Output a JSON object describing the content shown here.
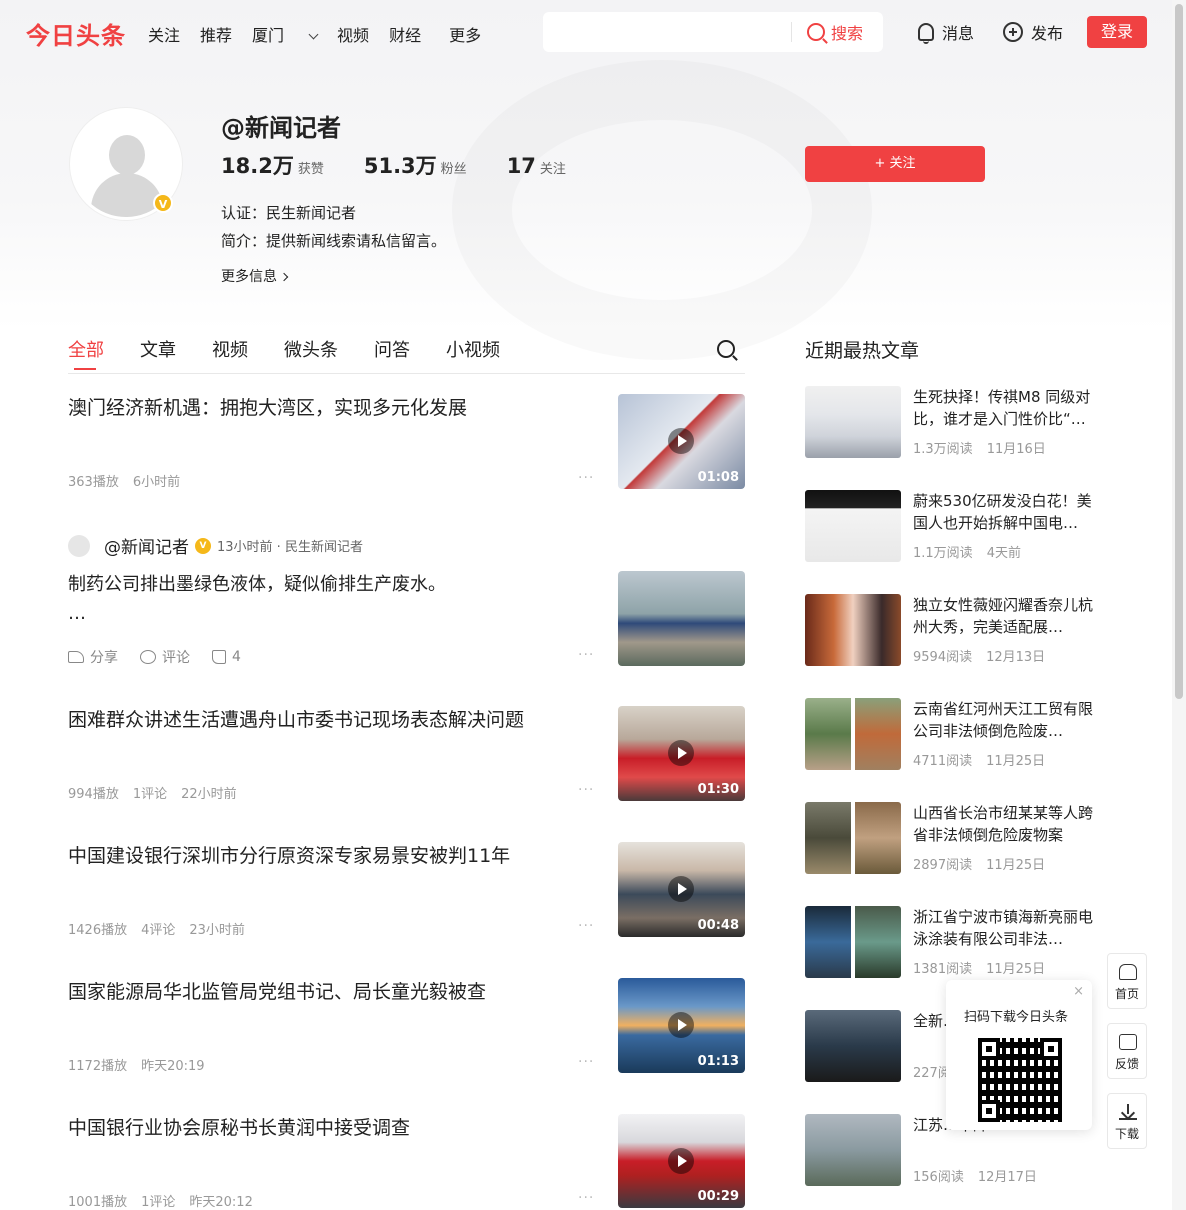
{
  "header": {
    "logo": "今日头条",
    "nav": [
      "关注",
      "推荐",
      "厦门",
      "视频",
      "财经",
      "更多"
    ],
    "search": {
      "placeholder": "",
      "button": "搜索"
    },
    "messages": "消息",
    "publish": "发布",
    "login": "登录"
  },
  "profile": {
    "name": "@新闻记者",
    "verified_badge": "V",
    "stats": [
      {
        "num": "18.2万",
        "unit": "获赞"
      },
      {
        "num": "51.3万",
        "unit": "粉丝"
      },
      {
        "num": "17",
        "unit": "关注"
      }
    ],
    "certification": "认证：民生新闻记者",
    "bio": "简介：提供新闻线索请私信留言。",
    "more_info": "更多信息",
    "follow_button": "+ 关注"
  },
  "tabs": [
    "全部",
    "文章",
    "视频",
    "微头条",
    "问答",
    "小视频"
  ],
  "feed": [
    {
      "title": "澳门经济新机遇：拥抱大湾区，实现多元化发展",
      "meta": [
        "363播放",
        "6小时前"
      ],
      "duration": "01:08"
    },
    {
      "type": "post",
      "author": "@新闻记者",
      "author_badge": "V",
      "time": "13小时前 · 民生新闻记者",
      "text": "制药公司排出墨绿色液体，疑似偷排生产废水。",
      "ellipsis": "…",
      "actions": {
        "share": "分享",
        "comment": "评论",
        "like": "4"
      }
    },
    {
      "title": "困难群众讲述生活遭遇舟山市委书记现场表态解决问题",
      "meta": [
        "994播放",
        "1评论",
        "22小时前"
      ],
      "duration": "01:30"
    },
    {
      "title": "中国建设银行深圳市分行原资深专家易景安被判11年",
      "meta": [
        "1426播放",
        "4评论",
        "23小时前"
      ],
      "duration": "00:48"
    },
    {
      "title": "国家能源局华北监管局党组书记、局长童光毅被查",
      "meta": [
        "1172播放",
        "昨天20:19"
      ],
      "duration": "01:13"
    },
    {
      "title": "中国银行业协会原秘书长黄润中接受调查",
      "meta": [
        "1001播放",
        "1评论",
        "昨天20:12"
      ],
      "duration": "00:29"
    }
  ],
  "feed_more": "···",
  "sidebar": {
    "title": "近期最热文章",
    "items": [
      {
        "title": "生死抉择！传祺M8 同级对比，谁才是入门性价比“…",
        "reads": "1.3万阅读",
        "date": "11月16日"
      },
      {
        "title": "蔚来530亿研发没白花！美国人也开始拆解中国电…",
        "reads": "1.1万阅读",
        "date": "4天前"
      },
      {
        "title": "独立女性薇娅闪耀香奈儿杭州大秀，完美适配展…",
        "reads": "9594阅读",
        "date": "12月13日"
      },
      {
        "title": "云南省红河州天江工贸有限公司非法倾倒危险废…",
        "reads": "4711阅读",
        "date": "11月25日"
      },
      {
        "title": "山西省长治市纽某某等人跨省非法倾倒危险废物案",
        "reads": "2897阅读",
        "date": "11月25日"
      },
      {
        "title": "浙江省宁波市镇海新亮丽电泳涂装有限公司非法…",
        "reads": "1381阅读",
        "date": "11月25日"
      },
      {
        "title": "全新…车感…",
        "reads": "227阅读",
        "date": ""
      },
      {
        "title": "江苏…不降…",
        "reads": "156阅读",
        "date": "12月17日"
      }
    ]
  },
  "qr_popup": {
    "label": "扫码下载今日头条",
    "close": "×"
  },
  "float_buttons": [
    "首页",
    "反馈",
    "下载"
  ],
  "colors": {
    "accent": "#f04142",
    "badge": "#f5b81a"
  }
}
